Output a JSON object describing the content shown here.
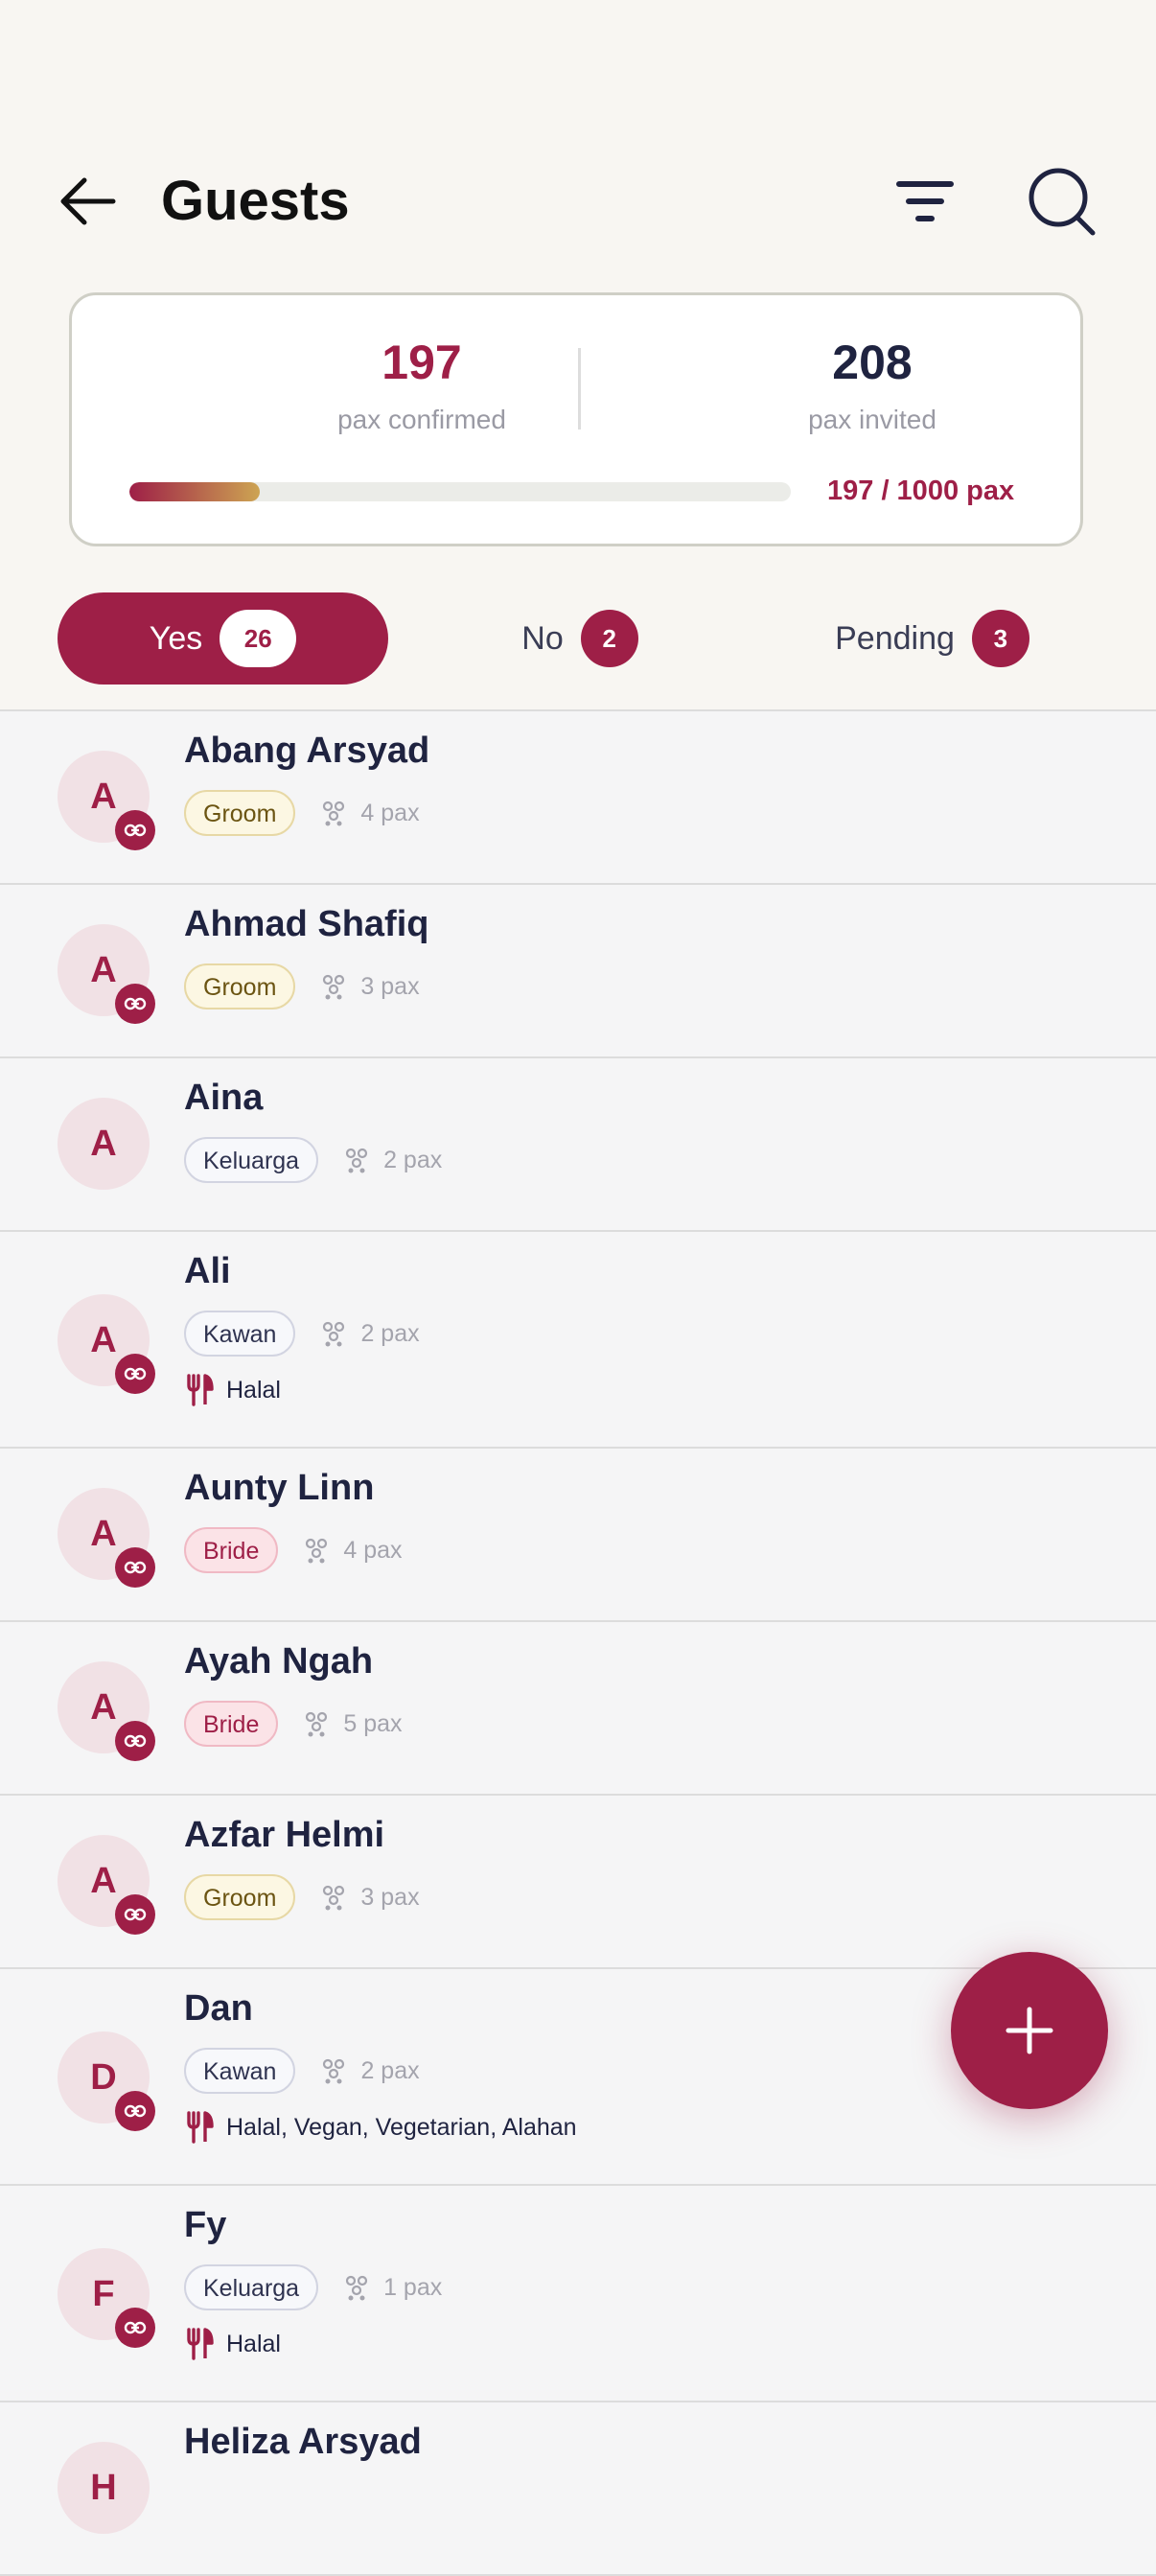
{
  "header": {
    "title": "Guests"
  },
  "summary": {
    "confirmed_value": "197",
    "confirmed_label": "pax confirmed",
    "invited_value": "208",
    "invited_label": "pax invited",
    "progress_label": "197 / 1000 pax",
    "progress_fraction": 0.197
  },
  "tabs": [
    {
      "label": "Yes",
      "count": "26"
    },
    {
      "label": "No",
      "count": "2"
    },
    {
      "label": "Pending",
      "count": "3"
    }
  ],
  "guests": [
    {
      "initial": "A",
      "name": "Abang Arsyad",
      "tag": "Groom",
      "pax": "4 pax",
      "linked": true,
      "diet": ""
    },
    {
      "initial": "A",
      "name": "Ahmad Shafiq",
      "tag": "Groom",
      "pax": "3 pax",
      "linked": true,
      "diet": ""
    },
    {
      "initial": "A",
      "name": "Aina",
      "tag": "Keluarga",
      "pax": "2 pax",
      "linked": false,
      "diet": ""
    },
    {
      "initial": "A",
      "name": "Ali",
      "tag": "Kawan",
      "pax": "2 pax",
      "linked": true,
      "diet": "Halal"
    },
    {
      "initial": "A",
      "name": "Aunty Linn",
      "tag": "Bride",
      "pax": "4 pax",
      "linked": true,
      "diet": ""
    },
    {
      "initial": "A",
      "name": "Ayah Ngah",
      "tag": "Bride",
      "pax": "5 pax",
      "linked": true,
      "diet": ""
    },
    {
      "initial": "A",
      "name": "Azfar Helmi",
      "tag": "Groom",
      "pax": "3 pax",
      "linked": true,
      "diet": ""
    },
    {
      "initial": "D",
      "name": "Dan",
      "tag": "Kawan",
      "pax": "2 pax",
      "linked": true,
      "diet": "Halal, Vegan, Vegetarian, Alahan"
    },
    {
      "initial": "F",
      "name": "Fy",
      "tag": "Keluarga",
      "pax": "1 pax",
      "linked": true,
      "diet": "Halal"
    },
    {
      "initial": "H",
      "name": "Heliza Arsyad",
      "tag": "",
      "pax": "",
      "linked": false,
      "diet": ""
    }
  ],
  "colors": {
    "accent": "#9e1f47",
    "gold": "#cda452"
  }
}
